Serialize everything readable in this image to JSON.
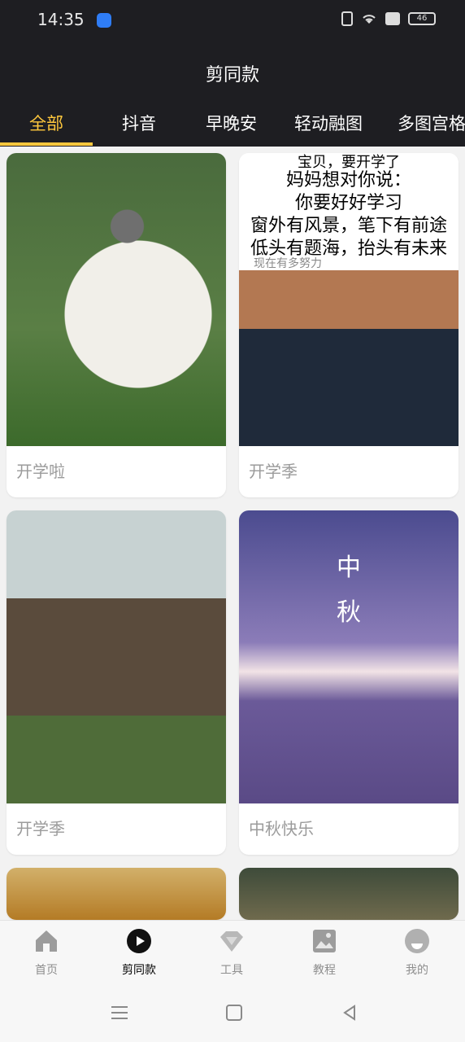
{
  "status": {
    "time": "14:35",
    "battery": "46"
  },
  "header": {
    "title": "剪同款"
  },
  "tabs": [
    {
      "label": "全部"
    },
    {
      "label": "抖音"
    },
    {
      "label": "早晚安"
    },
    {
      "label": "轻动融图"
    },
    {
      "label": "多图宫格"
    }
  ],
  "cards": [
    {
      "title": "开学啦"
    },
    {
      "title": "开学季",
      "poem": [
        "宝贝，要开学了",
        "妈妈想对你说：",
        "你要好好学习",
        "窗外有风景，笔下有前途",
        "低头有题海，抬头有未来"
      ],
      "subtitle": "现在有多努力"
    },
    {
      "title": "开学季"
    },
    {
      "title": "中秋快乐",
      "moon_top": "中",
      "moon_bottom": "秋"
    }
  ],
  "bottom_nav": [
    {
      "label": "首页",
      "icon": "home-icon"
    },
    {
      "label": "剪同款",
      "icon": "play-icon"
    },
    {
      "label": "工具",
      "icon": "diamond-icon"
    },
    {
      "label": "教程",
      "icon": "image-icon"
    },
    {
      "label": "我的",
      "icon": "profile-icon"
    }
  ],
  "colors": {
    "accent": "#ffc83d",
    "dark": "#1e1e22"
  }
}
